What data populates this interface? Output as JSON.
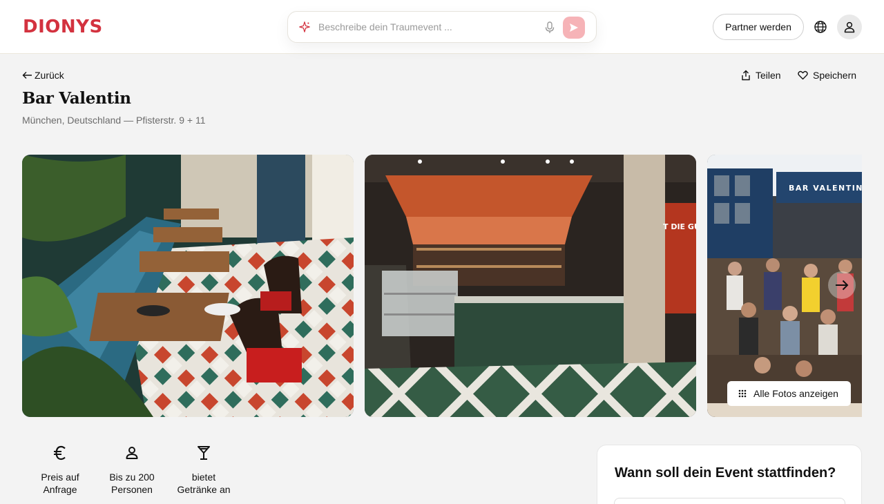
{
  "header": {
    "logo": "DIONYS",
    "search_placeholder": "Beschreibe dein Traumevent ...",
    "partner_button": "Partner werden",
    "icons": [
      "sparkle-icon",
      "microphone-icon",
      "send-icon",
      "globe-icon",
      "user-icon"
    ]
  },
  "venue": {
    "back_label": "Zurück",
    "share_label": "Teilen",
    "save_label": "Speichern",
    "name": "Bar Valentin",
    "location": "München, Deutschland — Pfisterstr. 9 + 11"
  },
  "gallery": {
    "photos": [
      "restaurant-terrace-photo",
      "bar-counter-photo",
      "event-crowd-photo"
    ],
    "photo3_sign": "BAR VALENTIN",
    "photo2_sign": "T DIE GUTE ALT",
    "all_photos_label": "Alle Fotos anzeigen"
  },
  "features": [
    {
      "icon": "euro-icon",
      "line1": "Preis auf",
      "line2": "Anfrage"
    },
    {
      "icon": "person-icon",
      "line1": "Bis zu 200",
      "line2": "Personen"
    },
    {
      "icon": "cocktail-icon",
      "line1": "bietet",
      "line2": "Getränke an"
    }
  ],
  "booking": {
    "title": "Wann soll dein Event stattfinden?"
  },
  "colors": {
    "brand": "#d3323f",
    "send_button": "#f6b3b7",
    "background": "#f3f3f3"
  }
}
